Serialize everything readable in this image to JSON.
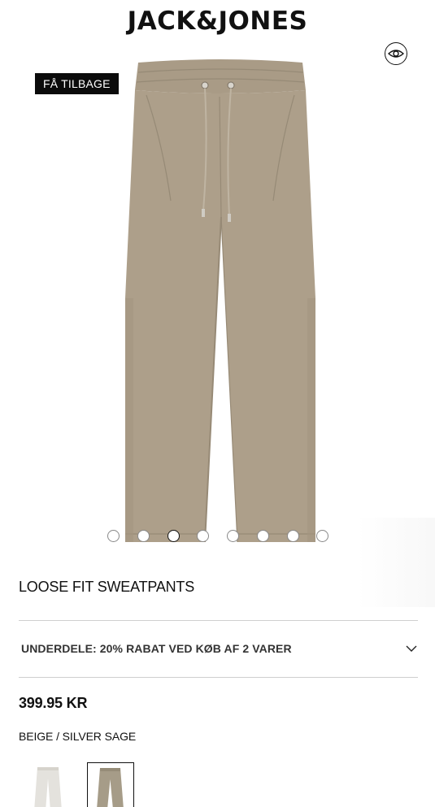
{
  "header": {
    "brand": "JACK&JONES",
    "logo_icon": "brand-logo"
  },
  "gallery": {
    "back_label": "FÅ TILBAGE",
    "view_icon": "eye-icon",
    "dots_count": 8,
    "active_dot": 3
  },
  "product": {
    "name": "LOOSE FIT SWEATPANTS",
    "promo": "UNDERDELE: 20% RABAT VED KØB AF 2 VARER",
    "promo_icon": "chevron-down-icon",
    "price": "399.95 KR",
    "color": "BEIGE / SILVER SAGE"
  },
  "swatches": [
    {
      "name": "light-grey",
      "color": "#e4e2dd",
      "selected": false
    },
    {
      "name": "silver-sage",
      "color": "#a69c88",
      "selected": true
    }
  ],
  "colors": {
    "pants": "#ad9f8a",
    "pants_shadow": "#9a8d79",
    "text": "#111111"
  }
}
